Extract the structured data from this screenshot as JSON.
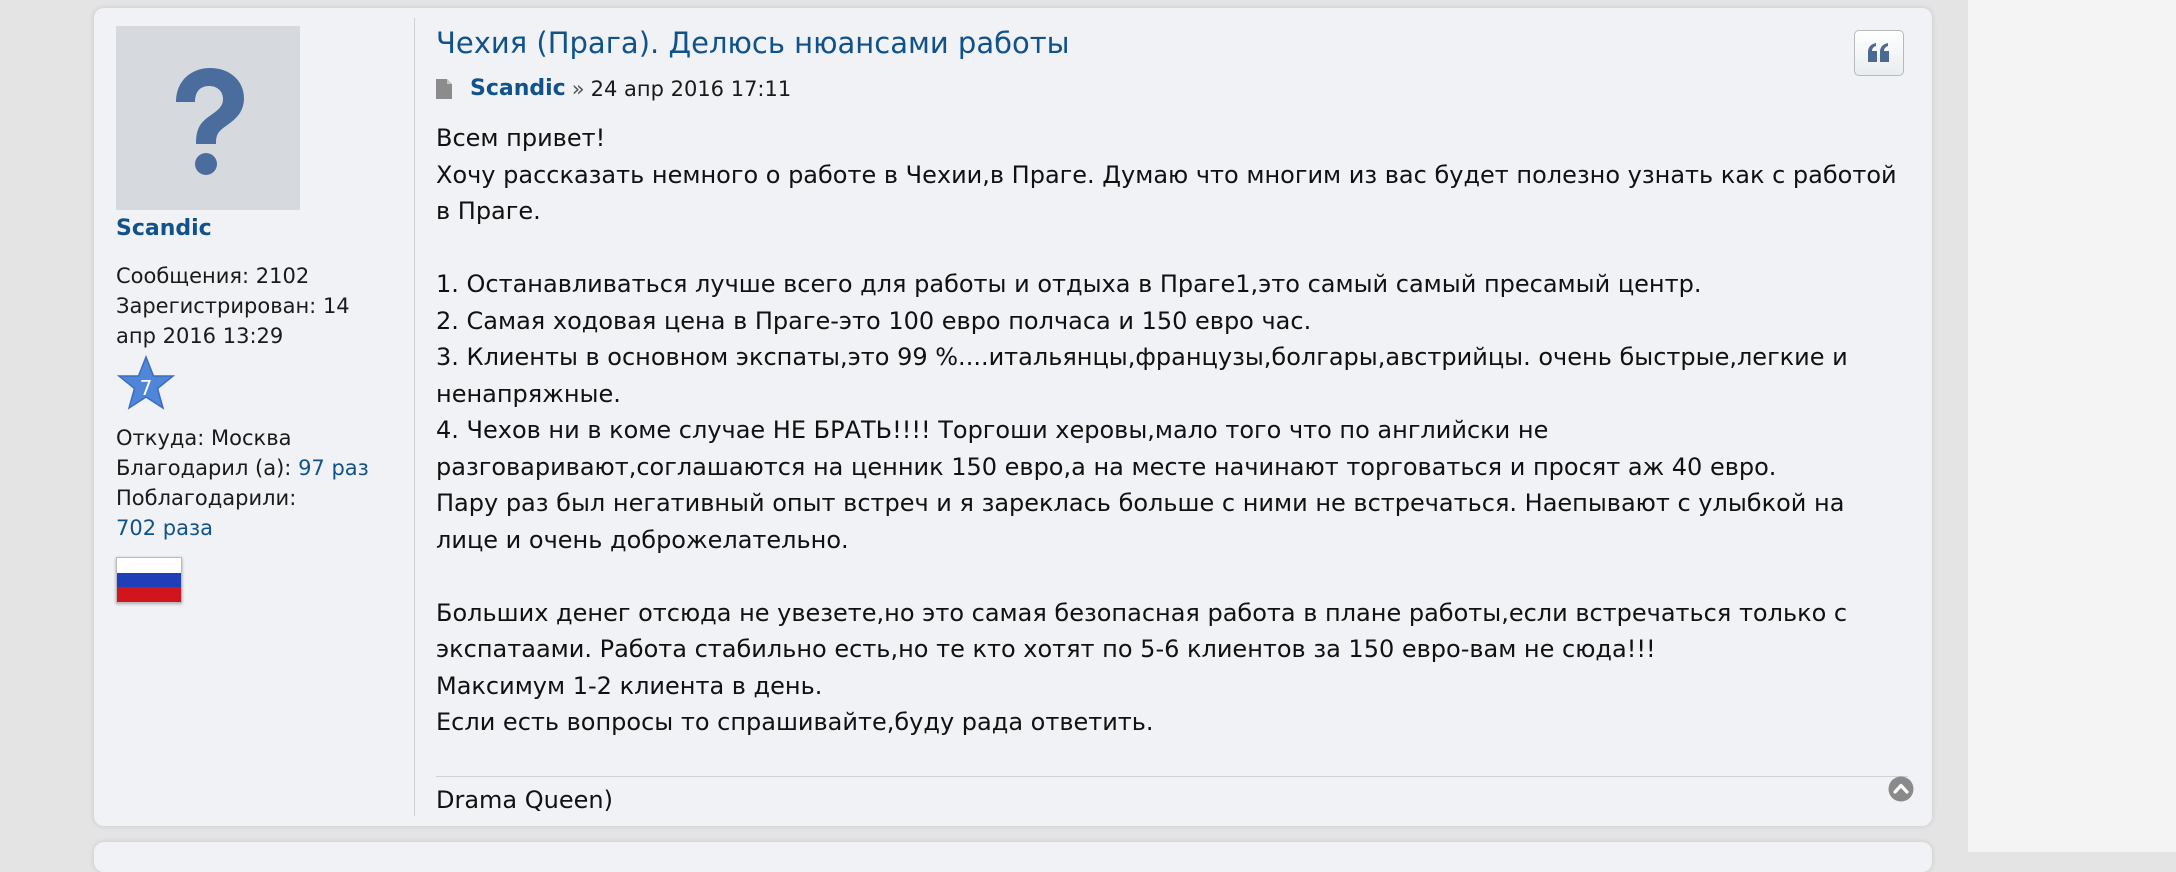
{
  "profile": {
    "username": "Scandic",
    "posts_label": "Сообщения:",
    "posts_value": "2102",
    "registered_label": "Зарегистрирован:",
    "registered_value_part1": "14",
    "registered_value_part2": "апр 2016 13:29",
    "rank_number": "7",
    "location_label": "Откуда:",
    "location_value": "Москва",
    "thanked_label": "Благодарил (а):",
    "thanked_value": "97 раз",
    "was_thanked_label": "Поблагодарили:",
    "was_thanked_value": "702 раза"
  },
  "post": {
    "title": "Чехия (Прага). Делюсь нюансами работы",
    "author": "Scandic",
    "separator": "»",
    "date": "24 апр 2016 17:11",
    "lines": [
      "Всем привет!",
      "Хочу рассказать немного о работе в Чехии,в Праге. Думаю что многим из вас будет полезно узнать как с работой в Праге.",
      "",
      "1. Останавливаться лучше всего для работы и отдыха в Праге1,это самый самый пресамый центр.",
      "2. Самая ходовая цена в Праге-это 100 евро полчаса и 150 евро час.",
      "3. Клиенты в основном экспаты,это 99 %....итальянцы,французы,болгары,австрийцы. очень быстрые,легкие и ненапряжные.",
      "4. Чехов ни в коме случае НЕ БРАТЬ!!!! Торгоши херовы,мало того что по английски не разговаривают,соглашаются на ценник 150 евро,а на месте начинают торговаться и просят аж 40 евро.",
      "Пару раз был негативный опыт встреч и я зареклась больше с ними не встречаться. Наепывают с улыбкой на лице и очень доброжелательно.",
      "",
      "Больших денег отсюда не увезете,но это самая безопасная работа в плане работы,если встречаться только с экспатаами. Работа стабильно есть,но те кто хотят по 5-6 клиентов за 150 евро-вам не сюда!!!",
      "Максимум 1-2 клиента в день.",
      "Если есть вопросы то спрашивайте,буду рада ответить."
    ],
    "signature": "Drama Queen)"
  },
  "icons": {
    "avatar": "question-mark-icon",
    "rank": "star-icon",
    "flag": "russia-flag-icon",
    "post": "document-icon",
    "quote": "quote-icon",
    "top": "arrow-up-circle-icon"
  },
  "colors": {
    "link": "#105289",
    "avatar_glyph": "#4a6d9e",
    "star": "#4f86d9"
  }
}
